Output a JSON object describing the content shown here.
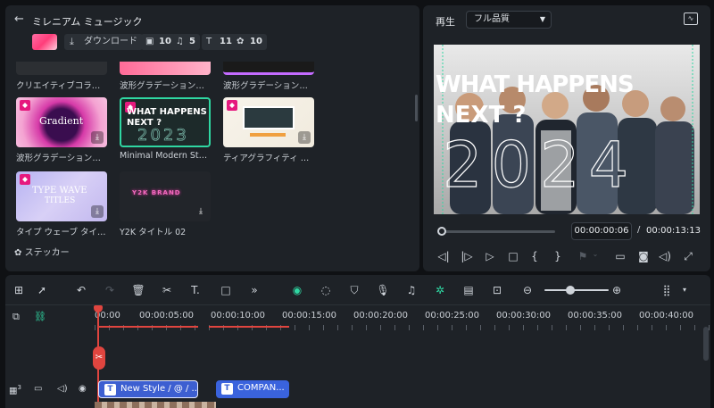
{
  "library": {
    "title": "ミレニアム ミュージック",
    "download_label": "ダウンロード",
    "stats": [
      {
        "icon": "folder-icon",
        "count": "10"
      },
      {
        "icon": "music-icon",
        "count": "5"
      },
      {
        "icon": "text-icon",
        "count": "11"
      },
      {
        "icon": "sticker-icon",
        "count": "10"
      }
    ],
    "items": [
      {
        "label": "クリエイティブコラー..."
      },
      {
        "label": "波形グラデーションパ..."
      },
      {
        "label": "波形グラデーションパ..."
      },
      {
        "label": "波形グラデーションパ...",
        "thumb_text": "Gradient"
      },
      {
        "label": "Minimal Modern Styl...",
        "thumb_line1": "WHAT HAPPENS",
        "thumb_line2": "NEXT ?",
        "thumb_year": "2023"
      },
      {
        "label": "ティアグラフィティ VI..."
      },
      {
        "label": "タイプ ウェーブ タイト...",
        "thumb_line1": "TYPE WAVE",
        "thumb_line2": "TITLES"
      },
      {
        "label": "Y2K タイトル 02",
        "thumb_text": "Y2K BRAND"
      }
    ],
    "sticker_label": "ステッカー"
  },
  "player": {
    "title": "再生",
    "quality": "フル品質",
    "headline1": "WHAT HAPPENS",
    "headline2": "NEXT ?",
    "year": "2024",
    "current_time": "00:00:00:06",
    "separator": "/",
    "total_time": "00:00:13:13"
  },
  "timeline": {
    "ruler": [
      "00:00",
      "00:00:05:00",
      "00:00:10:00",
      "00:00:15:00",
      "00:00:20:00",
      "00:00:25:00",
      "00:00:30:00",
      "00:00:35:00",
      "00:00:40:00"
    ],
    "track_number": "3",
    "clips": [
      {
        "label": "New Style / @ / ...",
        "color": "#3d5fd1"
      },
      {
        "label": "COMPAN...",
        "color": "#3a63dd"
      }
    ]
  },
  "colors": {
    "accent": "#2fd7a2",
    "playhead": "#e0453f",
    "clip": "#3d5fd1"
  }
}
